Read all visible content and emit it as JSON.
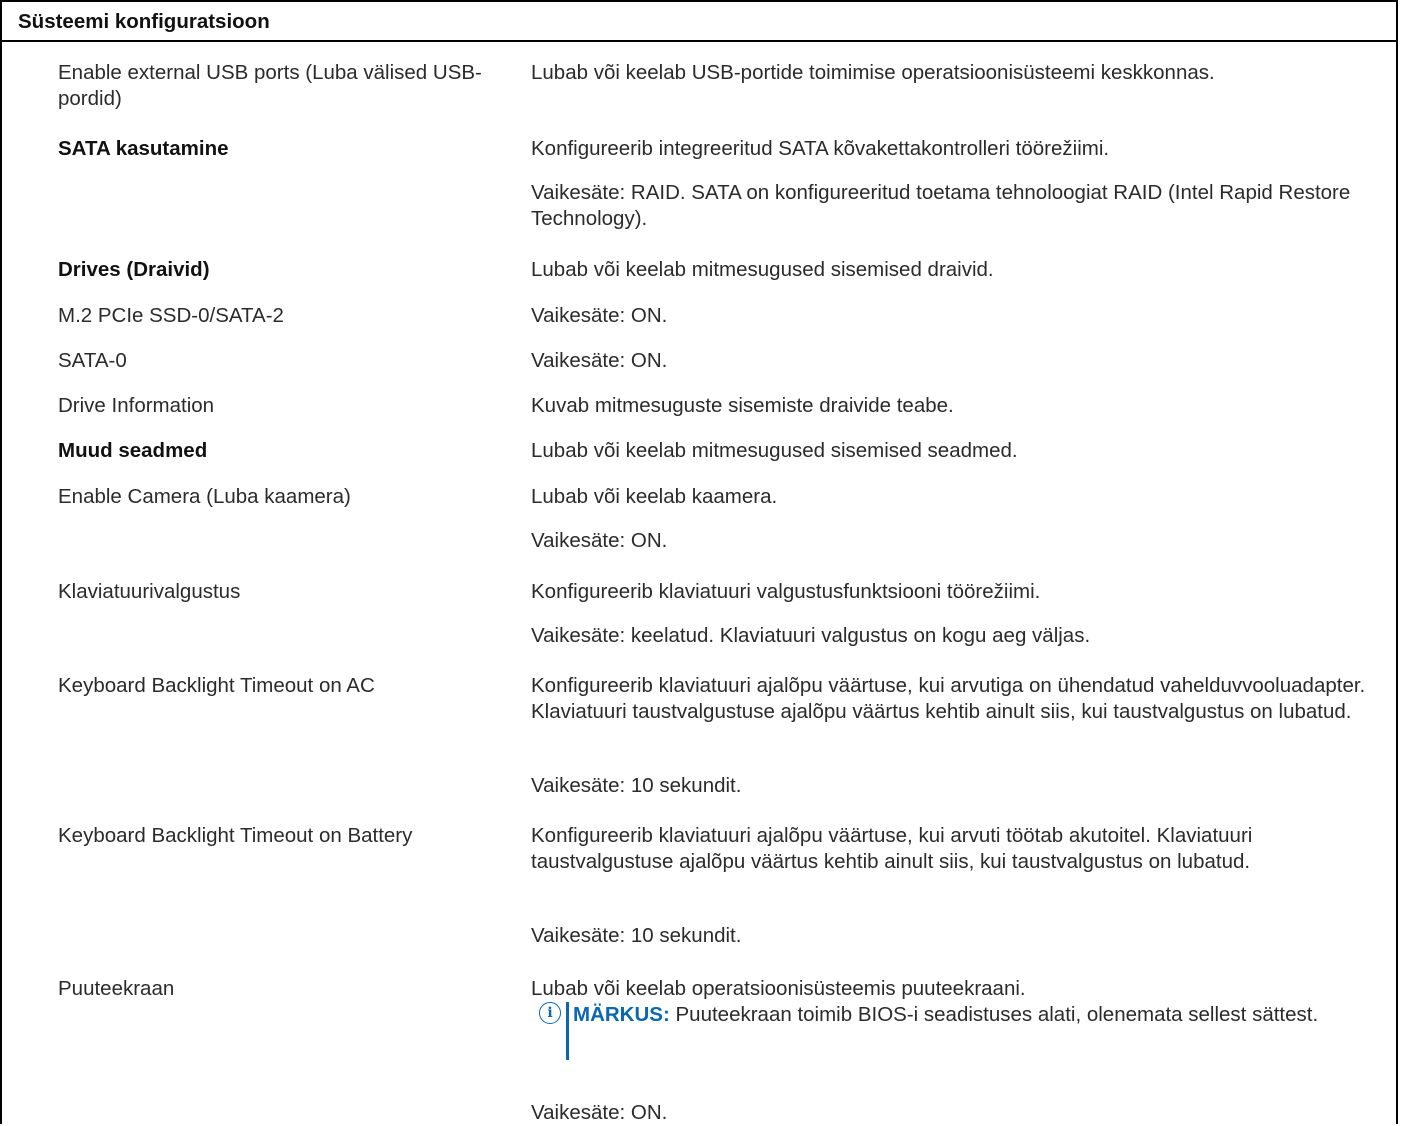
{
  "section_title": "Süsteemi konfiguratsioon",
  "rows": {
    "usb": {
      "label": "Enable external USB ports (Luba välised USB-pordid)",
      "desc": "Lubab või keelab USB-portide toimimise operatsioonisüsteemi keskkonnas."
    },
    "sata": {
      "label": "SATA kasutamine",
      "desc1": "Konfigureerib integreeritud SATA kõvakettakontrolleri töörežiimi.",
      "desc2": "Vaikesäte: RAID. SATA on konfigureeritud toetama tehnoloogiat RAID (Intel Rapid Restore Technology)."
    },
    "drives": {
      "label": "Drives (Draivid)",
      "desc": "Lubab või keelab mitmesugused sisemised draivid."
    },
    "m2": {
      "label": "M.2 PCIe SSD-0/SATA-2",
      "desc": "Vaikesäte: ON."
    },
    "sata0": {
      "label": "SATA-0",
      "desc": "Vaikesäte: ON."
    },
    "drive_info": {
      "label": "Drive Information",
      "desc": "Kuvab mitmesuguste sisemiste draivide teabe."
    },
    "other": {
      "label": "Muud seadmed",
      "desc": "Lubab või keelab mitmesugused sisemised seadmed."
    },
    "camera": {
      "label": "Enable Camera (Luba kaamera)",
      "desc1": "Lubab või keelab kaamera.",
      "desc2": "Vaikesäte: ON."
    },
    "kbd_light": {
      "label": "Klaviatuurivalgustus",
      "desc1": "Konfigureerib klaviatuuri valgustusfunktsiooni töörežiimi.",
      "desc2": "Vaikesäte: keelatud. Klaviatuuri valgustus on kogu aeg väljas."
    },
    "kbd_ac": {
      "label": "Keyboard Backlight Timeout on AC",
      "desc1": "Konfigureerib klaviatuuri ajalõpu väärtuse, kui arvutiga on ühendatud vahelduvvooluadapter. Klaviatuuri taustvalgustuse ajalõpu väärtus kehtib ainult siis, kui taustvalgustus on lubatud.",
      "desc2": "Vaikesäte: 10 sekundit."
    },
    "kbd_batt": {
      "label": "Keyboard Backlight Timeout on Battery",
      "desc1": "Konfigureerib klaviatuuri ajalõpu väärtuse, kui arvuti töötab akutoitel. Klaviatuuri taustvalgustuse ajalõpu väärtus kehtib ainult siis, kui taustvalgustus on lubatud.",
      "desc2": "Vaikesäte: 10 sekundit."
    },
    "touch": {
      "label": "Puuteekraan",
      "desc1": "Lubab või keelab operatsioonisüsteemis puuteekraani.",
      "note_label": "MÄRKUS:",
      "note_text": "Puuteekraan toimib BIOS-i seadistuses alati, olenemata sellest sättest.",
      "desc2": "Vaikesäte: ON."
    }
  },
  "note_icon_glyph": "i",
  "colors": {
    "accent": "#0a67b2",
    "border": "#000000",
    "text": "#2b2b2b"
  }
}
